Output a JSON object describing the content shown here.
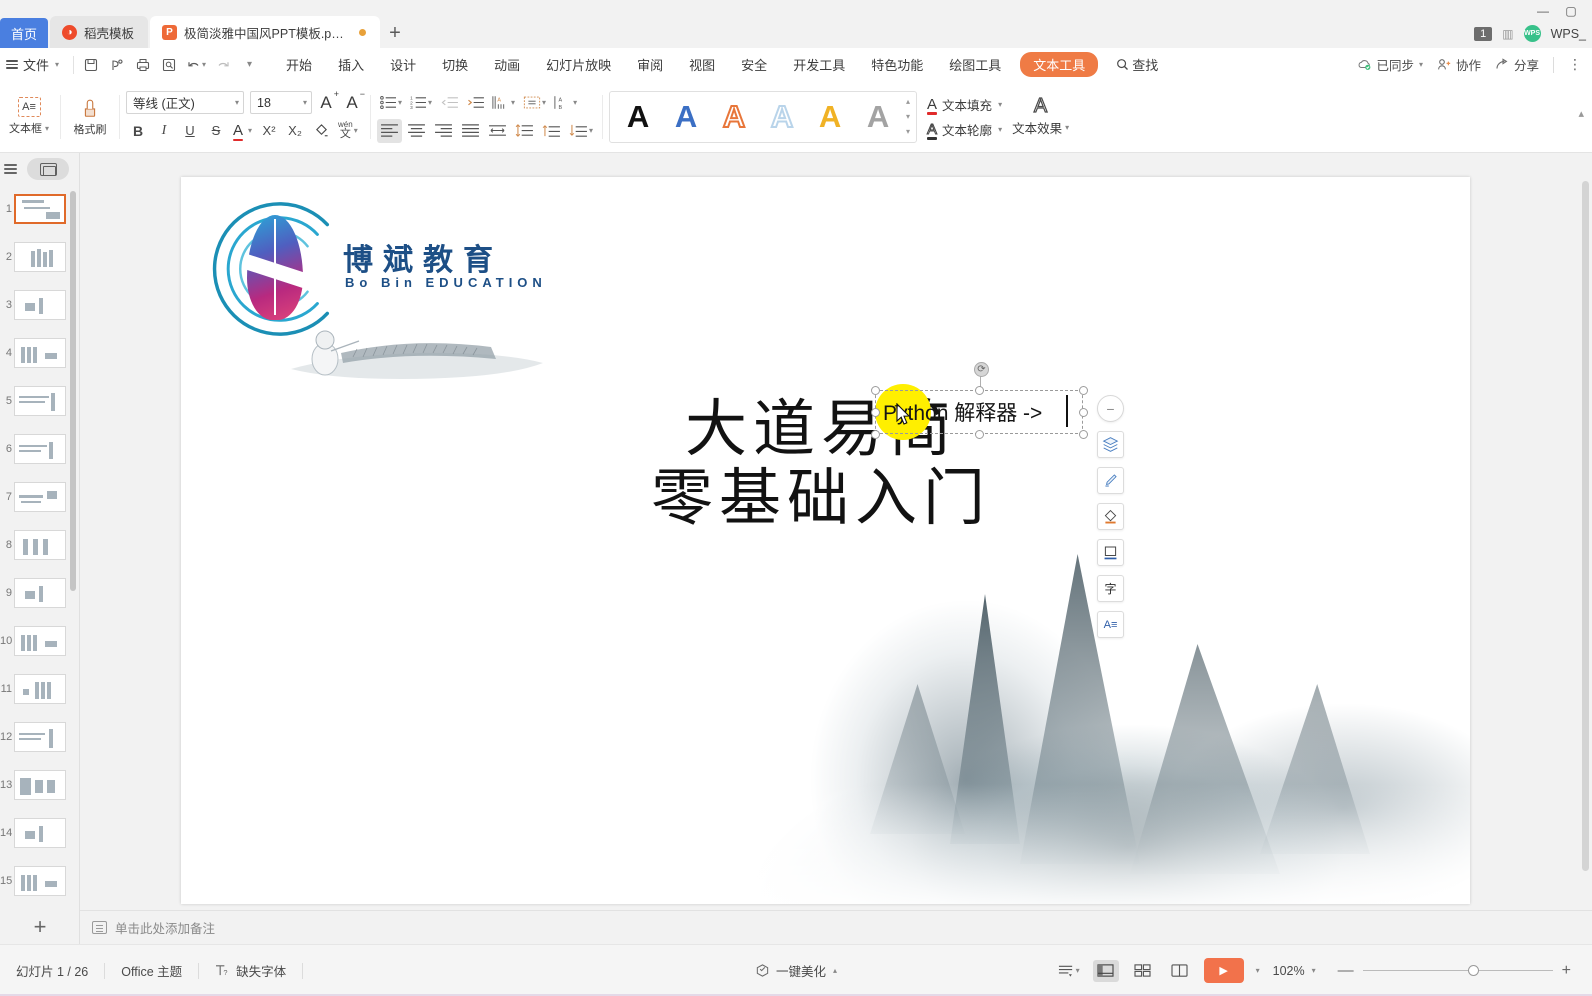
{
  "window": {
    "app_name": "WPS_",
    "badge_count": "1",
    "minimize": "—",
    "maximize": "▢"
  },
  "tabbar": {
    "home_label": "首页",
    "new_tab_label": "+",
    "tabs": [
      {
        "label": "稻壳模板",
        "icon": "template-icon",
        "active": false,
        "modified": false
      },
      {
        "label": "极简淡雅中国风PPT模板.pptx",
        "icon": "pptx-icon",
        "active": true,
        "modified": true
      }
    ]
  },
  "menubar": {
    "file_label": "文件",
    "quick_access": [
      "save-icon",
      "print-preview-icon",
      "print-icon",
      "search-doc-icon",
      "undo-icon",
      "redo-icon",
      "customize-icon"
    ],
    "items": [
      "开始",
      "插入",
      "设计",
      "切换",
      "动画",
      "幻灯片放映",
      "审阅",
      "视图",
      "安全",
      "开发工具",
      "特色功能",
      "绘图工具"
    ],
    "active_pill": "文本工具",
    "find_label": "查找",
    "right": [
      {
        "label": "已同步",
        "icon": "cloud-sync-icon",
        "caret": true
      },
      {
        "label": "协作",
        "icon": "collaborate-icon",
        "caret": false
      },
      {
        "label": "分享",
        "icon": "share-icon",
        "caret": false
      }
    ],
    "more_label": "⋮"
  },
  "ribbon": {
    "textbox_button": "文本框",
    "format_painter": "格式刷",
    "font_name": "等线 (正文)",
    "font_size": "18",
    "grow_font": "A",
    "shrink_font": "A",
    "bold": "B",
    "italic": "I",
    "underline": "U",
    "strikethrough": "S",
    "font_color": "A",
    "superscript": "X²",
    "subscript": "X₂",
    "clear_format": "clear-format-icon",
    "pinyin": "wén",
    "bullets": "bullet-list-icon",
    "numbering": "numbered-list-icon",
    "decrease_indent": "decrease-indent-icon",
    "increase_indent": "increase-indent-icon",
    "text_direction": "text-direction-icon",
    "align_text": "align-text-icon",
    "columns": "columns-icon",
    "align_left": "align-left-icon",
    "align_center": "align-center-icon",
    "align_right": "align-right-icon",
    "align_justify": "align-justify-icon",
    "distribute": "distribute-icon",
    "line_spacing": "line-spacing-icon",
    "space_before": "space-before-icon",
    "space_after": "space-after-icon",
    "wordart_styles": [
      {
        "name": "wordart-black",
        "glyph": "A",
        "color": "#111111",
        "outline": false
      },
      {
        "name": "wordart-blue",
        "glyph": "A",
        "color": "#3b6fc4",
        "outline": false
      },
      {
        "name": "wordart-orange-outline",
        "glyph": "A",
        "color": "#e8763a",
        "outline": true
      },
      {
        "name": "wordart-lightblue-outline",
        "glyph": "A",
        "color": "#b9d4ea",
        "outline": true
      },
      {
        "name": "wordart-yellow",
        "glyph": "A",
        "color": "#f0b225",
        "outline": false
      },
      {
        "name": "wordart-gray",
        "glyph": "A",
        "color": "#a3a3a3",
        "outline": false
      }
    ],
    "text_fill": "文本填充",
    "text_outline": "文本轮廓",
    "text_effects": "文本效果"
  },
  "sidebar": {
    "outline_icon": "outline-icon",
    "thumbnail_toggle": "thumbnail-view-icon",
    "selected_index": 1,
    "slides": [
      {
        "n": "1"
      },
      {
        "n": "2"
      },
      {
        "n": "3"
      },
      {
        "n": "4"
      },
      {
        "n": "5"
      },
      {
        "n": "6"
      },
      {
        "n": "7"
      },
      {
        "n": "8"
      },
      {
        "n": "9"
      },
      {
        "n": "10"
      },
      {
        "n": "11"
      },
      {
        "n": "12"
      },
      {
        "n": "13"
      },
      {
        "n": "14"
      },
      {
        "n": "15"
      }
    ],
    "add_slide": "+"
  },
  "slide": {
    "logo_cn": "博斌教育",
    "logo_en": "Bo Bin EDUCATION",
    "title_line1": "大道易简",
    "title_line2": "零基础入门",
    "textbox_text": "Python 解释器 ->"
  },
  "rail": {
    "buttons": [
      {
        "name": "collapse-rail-button",
        "glyph": "−"
      },
      {
        "name": "layers-icon",
        "glyph": "layers"
      },
      {
        "name": "brush-icon",
        "glyph": "brush"
      },
      {
        "name": "shape-fill-icon",
        "glyph": "fill"
      },
      {
        "name": "shape-outline-icon",
        "glyph": "outline"
      },
      {
        "name": "text-convert-icon",
        "glyph": "字"
      },
      {
        "name": "text-format-icon",
        "glyph": "A≡"
      }
    ]
  },
  "notes": {
    "placeholder": "单击此处添加备注"
  },
  "statusbar": {
    "slide_counter": "幻灯片 1 / 26",
    "theme": "Office 主题",
    "missing_font": "缺失字体",
    "beautify": "一键美化",
    "zoom_level": "102%",
    "zoom_out": "—",
    "zoom_in": "+",
    "views": [
      {
        "name": "view-options",
        "glyph": "≡"
      },
      {
        "name": "normal-view",
        "glyph": "normal",
        "active": true
      },
      {
        "name": "slide-sorter-view",
        "glyph": "grid",
        "active": false
      },
      {
        "name": "reading-view",
        "glyph": "book",
        "active": false
      }
    ],
    "play_label": "▶"
  }
}
